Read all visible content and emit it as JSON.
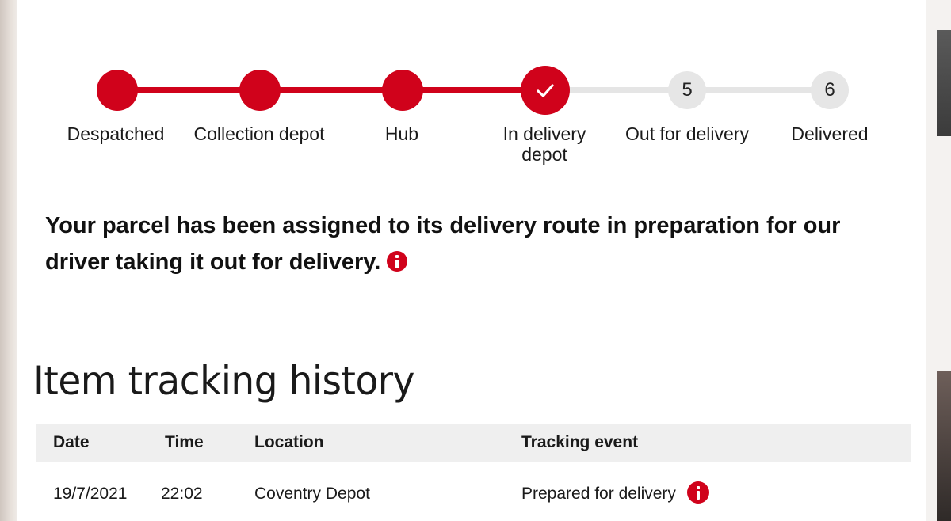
{
  "tracker": {
    "steps": [
      {
        "label": "Despatched",
        "state": "done"
      },
      {
        "label": "Collection depot",
        "state": "done"
      },
      {
        "label": "Hub",
        "state": "done"
      },
      {
        "label": "In delivery depot",
        "state": "current"
      },
      {
        "label": "Out for delivery",
        "number": "5",
        "state": "pending"
      },
      {
        "label": "Delivered",
        "number": "6",
        "state": "pending"
      }
    ]
  },
  "status_message": "Your parcel has been assigned to its delivery route in preparation for our driver taking it out for delivery.",
  "history": {
    "title": "Item tracking history",
    "columns": [
      "Date",
      "Time",
      "Location",
      "Tracking event"
    ],
    "rows": [
      {
        "date": "19/7/2021",
        "time": "22:02",
        "location": "Coventry Depot",
        "event": "Prepared for delivery"
      }
    ]
  },
  "colors": {
    "accent": "#d0021b",
    "pending": "#e6e6e6",
    "table_header_bg": "#efefef"
  },
  "icons": {
    "current_step": "check-icon",
    "status_info": "info-icon",
    "event_info": "info-icon"
  }
}
